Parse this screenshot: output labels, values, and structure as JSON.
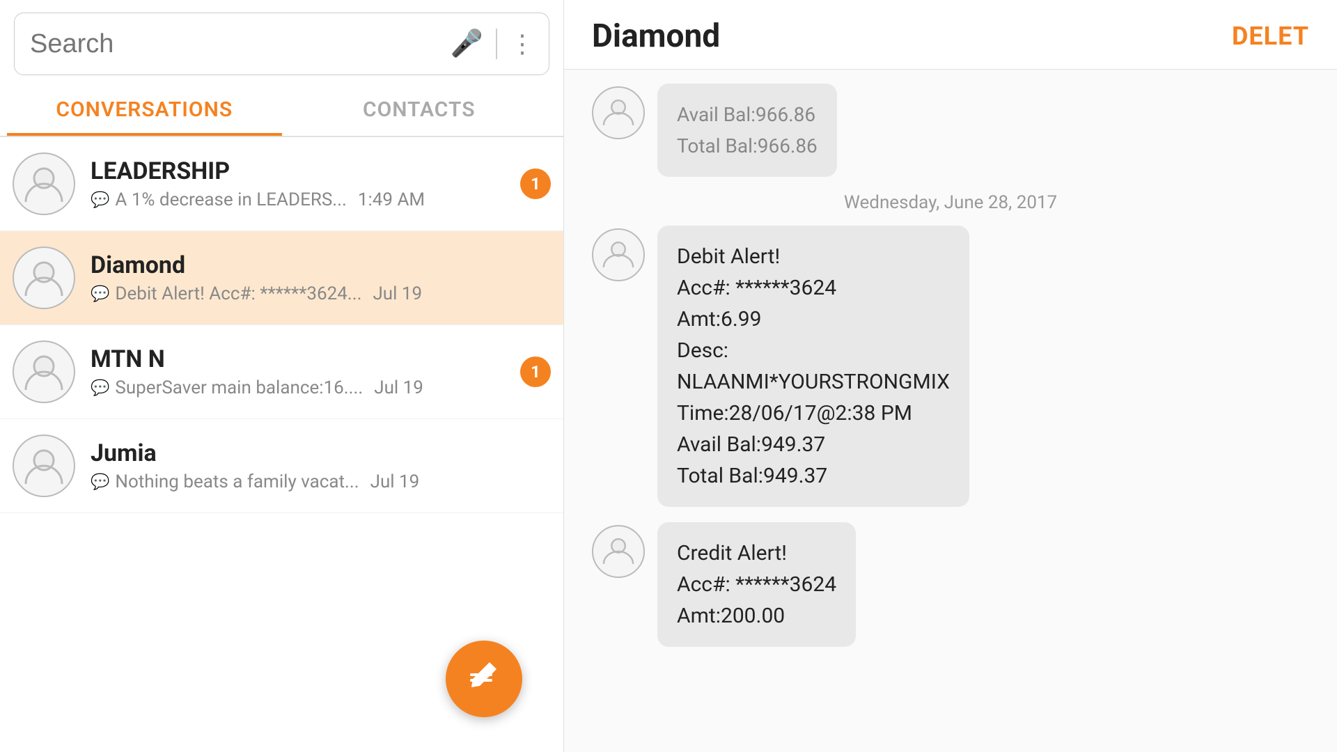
{
  "search": {
    "placeholder": "Search"
  },
  "tabs": {
    "conversations": "CONVERSATIONS",
    "contacts": "CONTACTS"
  },
  "conversations": [
    {
      "id": "1",
      "name": "LEADERSHIP",
      "preview": "A 1% decrease in LEADERS...",
      "time": "1:49 AM",
      "badge": "1",
      "selected": false
    },
    {
      "id": "2",
      "name": "Diamond",
      "preview": "Debit Alert! Acc#: ******3624...",
      "time": "Jul 19",
      "badge": null,
      "selected": true
    },
    {
      "id": "3",
      "name": "MTN N",
      "preview": "SuperSaver main balance:16....",
      "time": "Jul 19",
      "badge": "1",
      "selected": false
    },
    {
      "id": "4",
      "name": "Jumia",
      "preview": "Nothing beats a family vacat...",
      "time": "Jul 19",
      "badge": null,
      "selected": false
    }
  ],
  "chat": {
    "title": "Diamond",
    "delete_label": "DELET",
    "date_separator": "Wednesday, June 28, 2017",
    "messages": [
      {
        "id": "0",
        "partial_above": "Avail Bal:966.86\nTotal Bal:966.86",
        "full": ""
      },
      {
        "id": "1",
        "text": "Debit Alert!\nAcc#: ******3624\nAmt:6.99\nDesc:\nNLAANMI*YOURSTRONGMIX\nTime:28/06/17@2:38 PM\nAvail Bal:949.37\nTotal Bal:949.37"
      },
      {
        "id": "2",
        "text": "Credit Alert!\nAcc#: ******3624\nAmt:200.00"
      }
    ]
  },
  "fab": {
    "label": "compose"
  }
}
